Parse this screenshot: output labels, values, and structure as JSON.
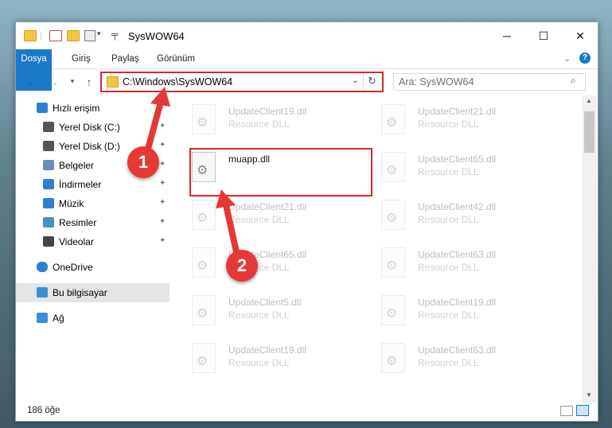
{
  "window": {
    "title": "SysWOW64"
  },
  "ribbon": {
    "tabs": [
      "Dosya",
      "Giriş",
      "Paylaş",
      "Görünüm"
    ]
  },
  "address": {
    "path": "C:\\Windows\\SysWOW64",
    "search_placeholder": "Ara: SysWOW64"
  },
  "nav": {
    "items": [
      {
        "label": "Hızlı erişim",
        "icon": "star-icon"
      },
      {
        "label": "Yerel Disk (C:)",
        "icon": "drive-icon",
        "pinned": true
      },
      {
        "label": "Yerel Disk (D:)",
        "icon": "drive-icon",
        "pinned": true
      },
      {
        "label": "Belgeler",
        "icon": "documents-icon",
        "pinned": true
      },
      {
        "label": "İndirmeler",
        "icon": "download-icon",
        "pinned": true
      },
      {
        "label": "Müzik",
        "icon": "music-icon",
        "pinned": true
      },
      {
        "label": "Resimler",
        "icon": "pictures-icon",
        "pinned": true
      },
      {
        "label": "Videolar",
        "icon": "video-icon",
        "pinned": true
      },
      {
        "label": "OneDrive",
        "icon": "cloud-icon"
      },
      {
        "label": "Bu bilgisayar",
        "icon": "computer-icon",
        "selected": true
      },
      {
        "label": "Ağ",
        "icon": "network-icon"
      }
    ]
  },
  "files": [
    {
      "name": "UpdateClient19.dll",
      "type": "Resource DLL"
    },
    {
      "name": "UpdateClient21.dll",
      "type": "Resource DLL"
    },
    {
      "name": "muapp.dll",
      "type": "",
      "highlighted": true
    },
    {
      "name": "UpdateClient65.dll",
      "type": "Resource DLL"
    },
    {
      "name": "UpdateClient21.dll",
      "type": "Resource DLL"
    },
    {
      "name": "UpdateClient42.dll",
      "type": "Resource DLL"
    },
    {
      "name": "UpdateClient65.dll",
      "type": "Resource DLL"
    },
    {
      "name": "UpdateClient63.dll",
      "type": "Resource DLL"
    },
    {
      "name": "UpdateClient5.dll",
      "type": "Resource DLL"
    },
    {
      "name": "UpdateClient19.dll",
      "type": "Resource DLL"
    },
    {
      "name": "UpdateClient19.dll",
      "type": "Resource DLL"
    },
    {
      "name": "UpdateClient63.dll",
      "type": "Resource DLL"
    }
  ],
  "status": {
    "count": "186 öğe"
  },
  "annotations": {
    "badge1": "1",
    "badge2": "2"
  },
  "colors": {
    "accent": "#1979ca",
    "highlight": "#d62a2a",
    "badge": "#e53935"
  }
}
